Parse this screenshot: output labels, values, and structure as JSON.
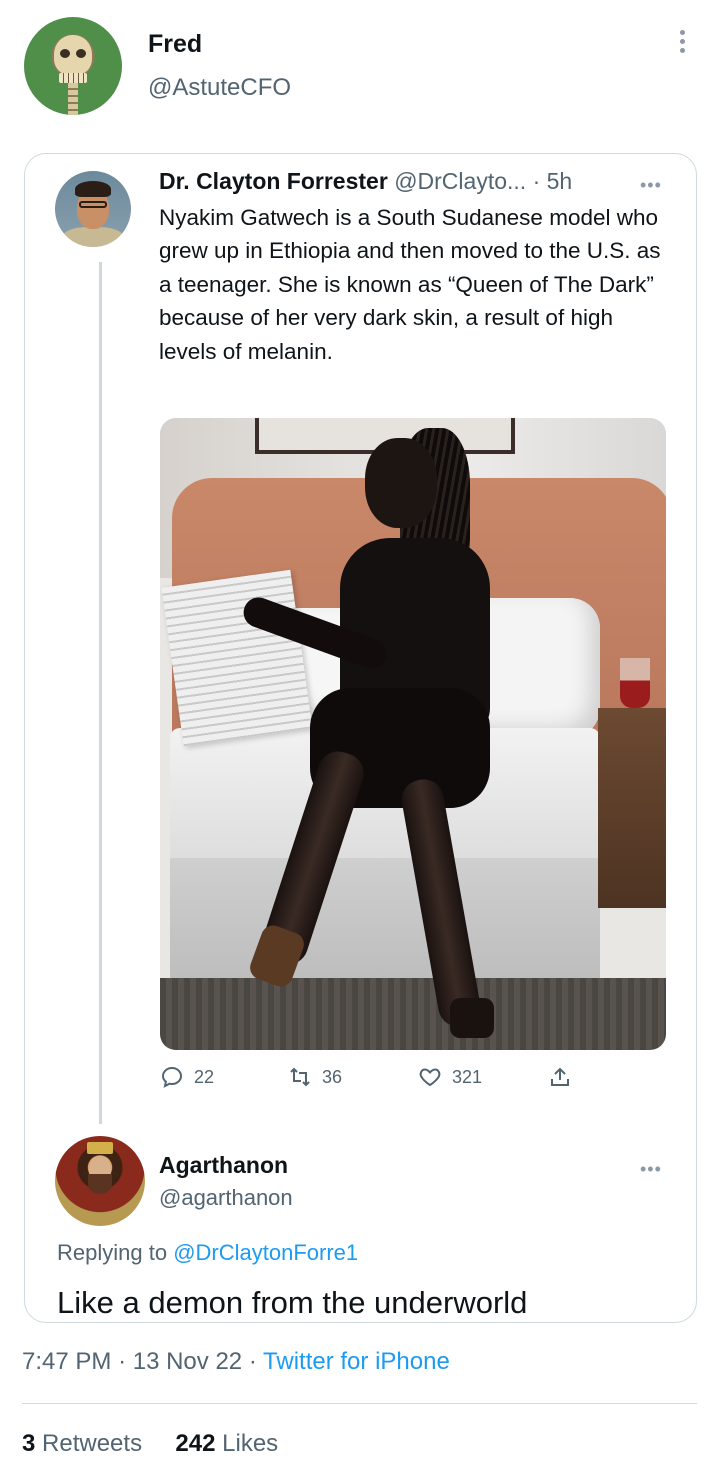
{
  "author": {
    "name": "Fred",
    "handle": "@AstuteCFO"
  },
  "quoted": {
    "name": "Dr. Clayton Forrester",
    "handle": "@DrClayto...",
    "separator": "·",
    "time": "5h",
    "text": "Nyakim Gatwech is a South Sudanese model who grew up in Ethiopia and then moved to the U.S. as a teenager. She is known as “Queen of The Dark” because of her very dark skin, a result of high levels of melanin.",
    "actions": {
      "replies": "22",
      "retweets": "36",
      "likes": "321"
    }
  },
  "reply": {
    "name": "Agarthanon",
    "handle": "@agarthanon",
    "replying_prefix": "Replying to",
    "replying_to": "@DrClaytonForre1",
    "text": "Like a demon from the underworld"
  },
  "meta": {
    "time": "7:47 PM",
    "date": "13 Nov 22",
    "source": "Twitter for iPhone",
    "dot": "·"
  },
  "stats": {
    "retweets_count": "3",
    "retweets_label": "Retweets",
    "likes_count": "242",
    "likes_label": "Likes"
  },
  "icons": {
    "more": "more-vertical-icon",
    "reply": "reply-icon",
    "retweet": "retweet-icon",
    "like": "heart-icon",
    "share": "share-icon"
  },
  "colors": {
    "text": "#0f1419",
    "secondary": "#536471",
    "link": "#1d9bf0",
    "border": "#cfd9de"
  }
}
